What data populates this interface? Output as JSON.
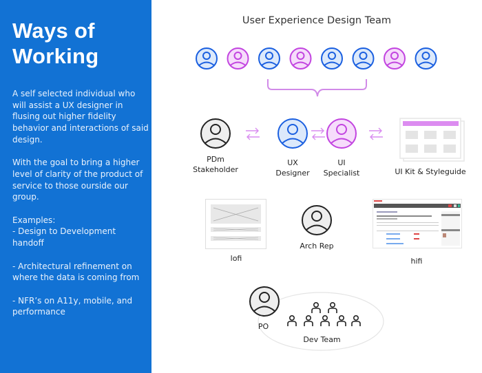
{
  "sidebar": {
    "title_line1": "Ways of",
    "title_line2": "Working",
    "paragraphs": [
      "A self selected individual who will assist a UX designer in flusing out higher fidelity behavior and interactions of said design.",
      "With the goal to bring a higher level of clarity of the product of service to those ourside our group.",
      "Examples:\n- Design to Development handoff",
      "- Architectural refinement on where the data is coming from",
      "- NFR’s on A11y, mobile, and performance"
    ]
  },
  "diagram": {
    "team_title": "User Experience Design Team",
    "team_members": [
      {
        "role": "ux",
        "color": "blue"
      },
      {
        "role": "ui",
        "color": "purple"
      },
      {
        "role": "ux",
        "color": "blue"
      },
      {
        "role": "ui",
        "color": "purple"
      },
      {
        "role": "ux",
        "color": "blue"
      },
      {
        "role": "ux",
        "color": "blue"
      },
      {
        "role": "ui",
        "color": "purple"
      },
      {
        "role": "ux",
        "color": "blue"
      }
    ],
    "pdm_label": "PDm\nStakeholder",
    "ux_label": "UX\nDesigner",
    "ui_label": "UI\nSpecialist",
    "uikit_label": "UI Kit & Styleguide",
    "lofi_label": "lofi",
    "arch_label": "Arch Rep",
    "hifi_label": "hifi",
    "po_label": "PO",
    "devteam_label": "Dev Team"
  },
  "colors": {
    "sidebar_bg": "#1272d4",
    "blue": "#1a5fe0",
    "blue_fill": "#dce9fb",
    "purple": "#c244e0",
    "purple_fill": "#f6dcfb",
    "bracket": "#d18ae8",
    "arrow": "#d98cf0",
    "neutral": "#222222",
    "neutral_fill": "#eeeeee"
  }
}
